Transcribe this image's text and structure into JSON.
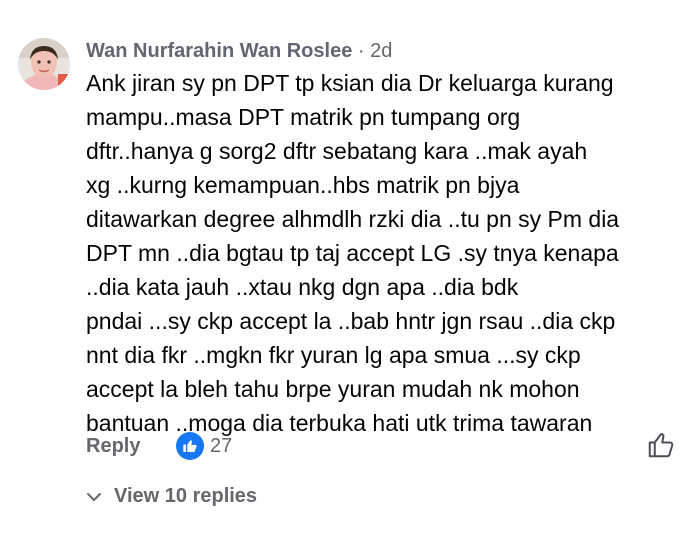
{
  "comment": {
    "author": "Wan Nurfarahin Wan Roslee",
    "separator": "·",
    "timestamp": "2d",
    "avatar_icon": "profile-photo",
    "body": "Ank jiran sy pn DPT tp ksian dia Dr keluarga kurang\nmampu..masa DPT matrik pn tumpang org\ndftr..hanya g sorg2 dftr sebatang kara  ..mak ayah\nxg ..kurng kemampuan..hbs matrik pn bjya\nditawarkan degree alhmdlh rzki dia ..tu pn sy Pm dia\nDPT mn ..dia bgtau tp taj accept LG .sy tnya kenapa\n..dia kata jauh ..xtau nkg dgn apa ..dia bdk\npndai ...sy ckp accept la ..bab hntr jgn rsau ..dia ckp\nnnt dia fkr ..mgkn fkr yuran lg apa smua ...sy ckp\naccept la bleh tahu brpe yuran mudah nk mohon\nbantuan ..moga dia terbuka hati utk trima tawaran"
  },
  "actions": {
    "reply_label": "Reply",
    "reaction_icon": "thumbs-up-icon",
    "reaction_count": "27",
    "like_icon": "thumbs-up-outline-icon"
  },
  "replies": {
    "label": "View 10 replies",
    "icon": "chevron-down-icon"
  },
  "colors": {
    "text": "#050505",
    "secondary": "#65676b",
    "reaction_blue": "#1877f2"
  }
}
